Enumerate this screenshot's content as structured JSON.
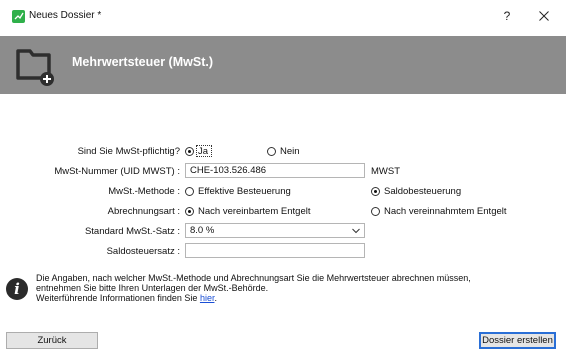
{
  "window": {
    "title": "Neues Dossier *",
    "help_label": "?",
    "close_label": "✕"
  },
  "header": {
    "title": "Mehrwertsteuer (MwSt.)"
  },
  "form": {
    "mwst_pflichtig": {
      "label": "Sind Sie MwSt-pflichtig?",
      "options": [
        "Ja",
        "Nein"
      ],
      "selected": "Ja"
    },
    "uid": {
      "label": "MwSt-Nummer (UID MWST) :",
      "value": "CHE-103.526.486",
      "suffix": "MWST"
    },
    "methode": {
      "label": "MwSt.-Methode :",
      "options": [
        "Effektive Besteuerung",
        "Saldobesteuerung"
      ],
      "selected": "Saldobesteuerung"
    },
    "abrechnungsart": {
      "label": "Abrechnungsart :",
      "options": [
        "Nach vereinbartem Entgelt",
        "Nach vereinnahmtem Entgelt"
      ],
      "selected": "Nach vereinbartem Entgelt"
    },
    "standard_satz": {
      "label": "Standard MwSt.-Satz :",
      "value": "8.0 %"
    },
    "saldosteuersatz": {
      "label": "Saldosteuersatz :",
      "value": ""
    }
  },
  "info": {
    "line1": "Die Angaben, nach welcher MwSt.-Methode und Abrechnungsart Sie die Mehrwertsteuer abrechnen müssen,",
    "line2": "entnehmen Sie bitte Ihren Unterlagen der MwSt.-Behörde.",
    "line3_prefix": "Weiterführende Informationen finden Sie ",
    "line3_link": "hier",
    "line3_suffix": "."
  },
  "buttons": {
    "back_label": "Zurück",
    "create_label": "Dossier erstellen"
  },
  "colors": {
    "header_bg": "#8c8c8c",
    "app_icon": "#2fb04a",
    "link": "#1a4fd6",
    "default_button_border": "#2a6fd6"
  }
}
